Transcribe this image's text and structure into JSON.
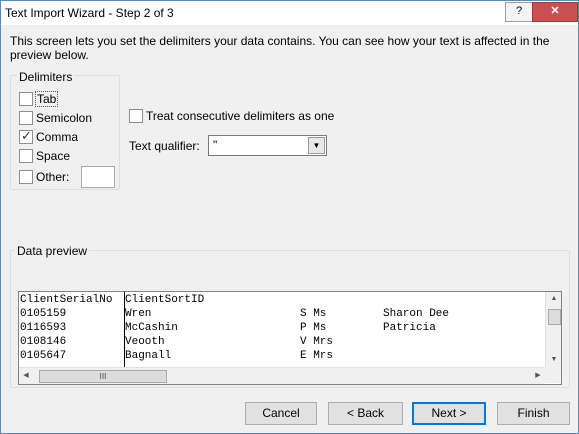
{
  "window": {
    "title": "Text Import Wizard - Step 2 of 3",
    "help_label": "?",
    "close_label": "✕"
  },
  "description": "This screen lets you set the delimiters your data contains.  You can see how your text is affected in the preview below.",
  "delimiters": {
    "group_label": "Delimiters",
    "options": [
      {
        "label": "Tab",
        "checked": false
      },
      {
        "label": "Semicolon",
        "checked": false
      },
      {
        "label": "Comma",
        "checked": true
      },
      {
        "label": "Space",
        "checked": false
      },
      {
        "label": "Other:",
        "checked": false
      }
    ],
    "other_value": ""
  },
  "consecutive": {
    "label": "Treat consecutive delimiters as one",
    "checked": false
  },
  "qualifier": {
    "label": "Text qualifier:",
    "value": "\""
  },
  "preview": {
    "group_label": "Data preview",
    "rows": [
      [
        "ClientSerialNo",
        "ClientSortID",
        "",
        ""
      ],
      [
        "0105159",
        "Wren",
        "S Ms",
        "Sharon Dee"
      ],
      [
        "0116593",
        "McCashin",
        "P Ms",
        "Patricia"
      ],
      [
        "0108146",
        "Veooth",
        "V Mrs",
        ""
      ],
      [
        "0105647",
        "Bagnall",
        "E Mrs",
        ""
      ]
    ],
    "hscroll_grip": "III"
  },
  "buttons": {
    "cancel": "Cancel",
    "back": "< Back",
    "next": "Next >",
    "finish": "Finish"
  }
}
